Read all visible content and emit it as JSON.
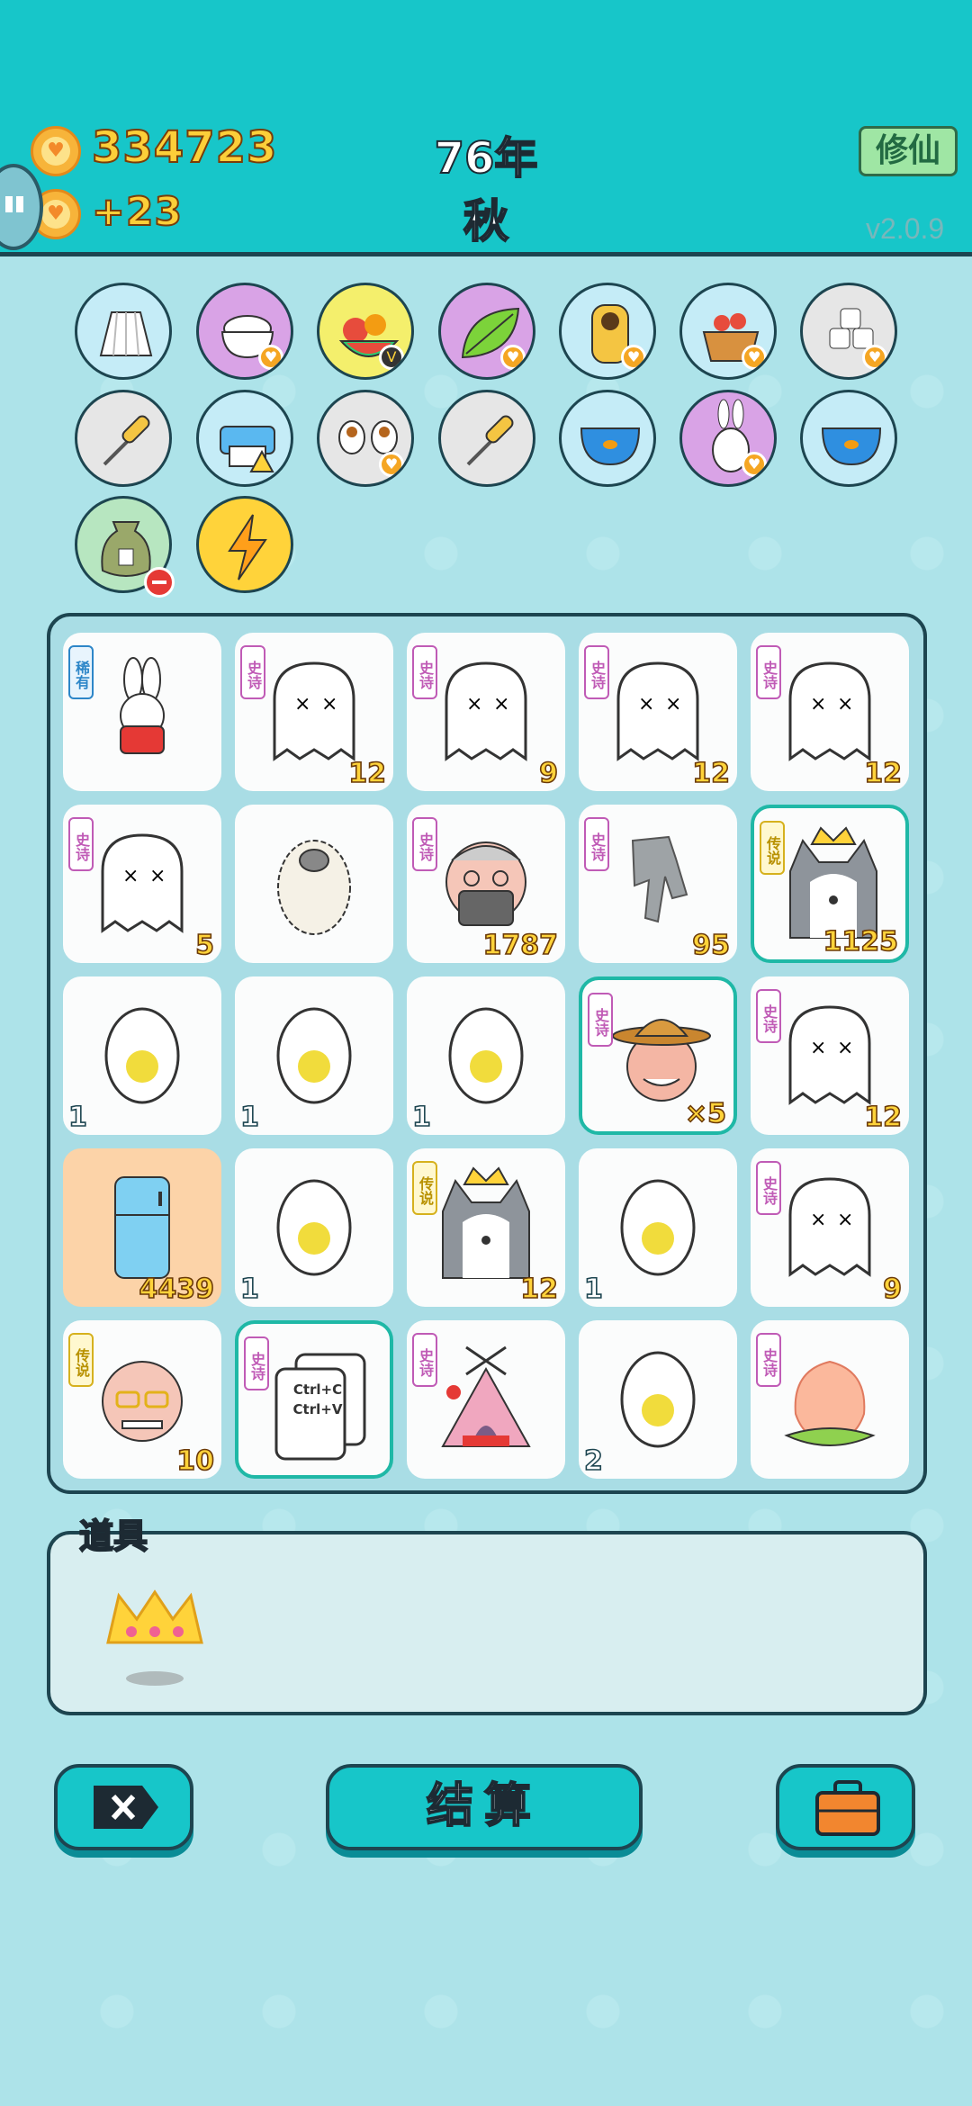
{
  "header": {
    "coins": "334723",
    "coins_gain": "+23",
    "year": "76年",
    "season": "秋",
    "mode_button": "修仙",
    "version": "v2.0.9"
  },
  "board": {
    "cells": [
      {
        "rarity": "稀有",
        "count": ""
      },
      {
        "rarity": "史诗",
        "count": "12"
      },
      {
        "rarity": "史诗",
        "count": "9"
      },
      {
        "rarity": "史诗",
        "count": "12"
      },
      {
        "rarity": "史诗",
        "count": "12"
      },
      {
        "rarity": "史诗",
        "count": "5"
      },
      {
        "rarity": "",
        "count": ""
      },
      {
        "rarity": "史诗",
        "count": "1787"
      },
      {
        "rarity": "史诗",
        "count": "95"
      },
      {
        "rarity": "传说",
        "count": "1125"
      },
      {
        "rarity": "",
        "count": "1"
      },
      {
        "rarity": "",
        "count": "1"
      },
      {
        "rarity": "",
        "count": "1"
      },
      {
        "rarity": "史诗",
        "count": "×5"
      },
      {
        "rarity": "史诗",
        "count": "12"
      },
      {
        "rarity": "",
        "count": "4439"
      },
      {
        "rarity": "",
        "count": "1"
      },
      {
        "rarity": "传说",
        "count": "12"
      },
      {
        "rarity": "",
        "count": "1"
      },
      {
        "rarity": "史诗",
        "count": "9"
      },
      {
        "rarity": "传说",
        "count": "10"
      },
      {
        "rarity": "史诗",
        "count": ""
      },
      {
        "rarity": "史诗",
        "count": ""
      },
      {
        "rarity": "",
        "count": "2"
      },
      {
        "rarity": "史诗",
        "count": ""
      }
    ],
    "copy_card_top": "Ctrl+C",
    "copy_card_bottom": "Ctrl+V"
  },
  "props": {
    "label": "道具"
  },
  "buttons": {
    "settle": "结算"
  }
}
